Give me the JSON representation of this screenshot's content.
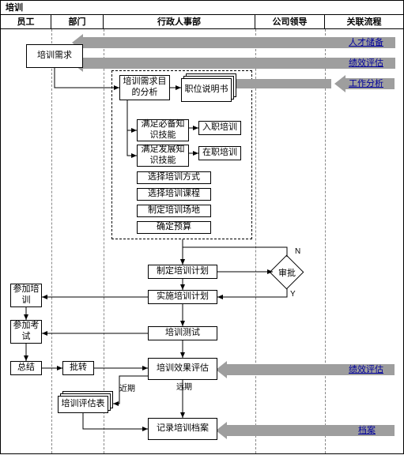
{
  "title": "培训",
  "columns": [
    "员工",
    "部门",
    "行政人事部",
    "公司领导",
    "关联流程"
  ],
  "links": {
    "talent_reserve": "人才储备",
    "performance_eval": "绩效评估",
    "job_analysis": "工作分析",
    "performance_eval2": "绩效评估",
    "archive": "档案"
  },
  "boxes": {
    "training_need": "培训需求",
    "need_analysis": "培训需求目的分析",
    "job_desc": "职位说明书",
    "meet_basic": "满足必备知识技能",
    "meet_dev": "满足发展知识技能",
    "onboard_training": "入职培训",
    "onjob_training": "在职培训",
    "choose_method": "选择培训方式",
    "choose_course": "选择培训课程",
    "set_venue": "制定培训场地",
    "set_budget": "确定预算",
    "make_plan": "制定培训计划",
    "exec_plan": "实施培训计划",
    "training_test": "培训测试",
    "effect_eval": "培训效果评估",
    "record_archive": "记录培训档案",
    "attend_training": "参加培训",
    "attend_exam": "参加考试",
    "summary": "总结",
    "forward": "批转",
    "eval_form": "培训评估表"
  },
  "decision": {
    "approval": "审批"
  },
  "labels": {
    "N": "N",
    "Y": "Y",
    "long_term": "远期",
    "short_term": "近期"
  }
}
